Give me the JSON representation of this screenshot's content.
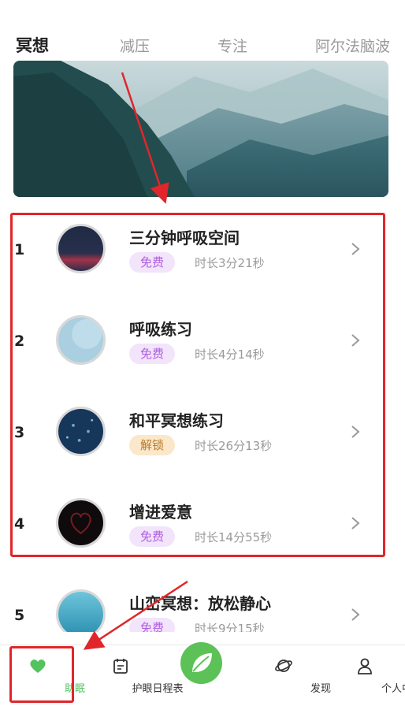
{
  "tabs": [
    {
      "label": "冥想",
      "active": true
    },
    {
      "label": "减压",
      "active": false
    },
    {
      "label": "专注",
      "active": false
    },
    {
      "label": "阿尔法脑波",
      "active": false
    }
  ],
  "items": [
    {
      "num": "1",
      "title": "三分钟呼吸空间",
      "badge": "免费",
      "badge_type": "free",
      "duration": "时长3分21秒"
    },
    {
      "num": "2",
      "title": "呼吸练习",
      "badge": "免费",
      "badge_type": "free",
      "duration": "时长4分14秒"
    },
    {
      "num": "3",
      "title": "和平冥想练习",
      "badge": "解锁",
      "badge_type": "unlock",
      "duration": "时长26分13秒"
    },
    {
      "num": "4",
      "title": "增进爱意",
      "badge": "免费",
      "badge_type": "free",
      "duration": "时长14分55秒"
    },
    {
      "num": "5",
      "title": "山峦冥想：放松静心",
      "badge": "免费",
      "badge_type": "free",
      "duration": "时长9分15秒"
    }
  ],
  "bottom_nav": [
    {
      "label": "助眠",
      "icon": "heart-icon",
      "active": true
    },
    {
      "label": "护眼日程表",
      "icon": "calendar-icon",
      "active": false
    },
    {
      "label": "",
      "icon": "leaf-icon",
      "active": false
    },
    {
      "label": "发现",
      "icon": "planet-icon",
      "active": false
    },
    {
      "label": "个人中心",
      "icon": "person-icon",
      "active": false
    }
  ],
  "colors": {
    "accent_green": "#54c25f",
    "annotation_red": "#e0262a",
    "free_badge_bg": "#f1e4fb",
    "unlock_badge_bg": "#fbe7c9"
  }
}
